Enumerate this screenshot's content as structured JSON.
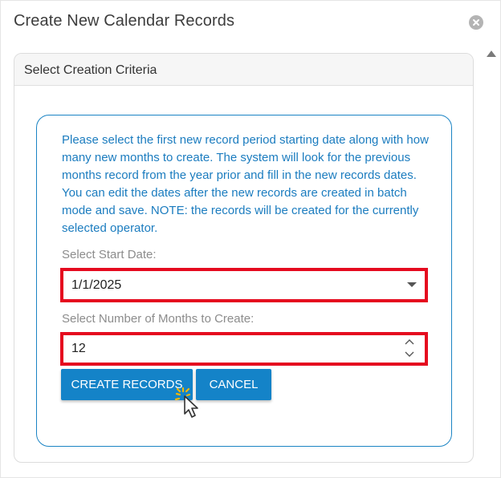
{
  "dialog": {
    "title": "Create New Calendar Records",
    "close_icon": "close-circle-icon",
    "scroll_icon": "scroll-up-arrow-icon"
  },
  "panel": {
    "header": "Select Creation Criteria",
    "instructions": "Please select the first new record period starting date along with how many new months to create. The system will look for the previous months record from the year prior and fill in the new records dates. You can edit the dates after the new records are created in batch mode and save. NOTE: the records will be created for the currently selected operator.",
    "start_date": {
      "label": "Select Start Date:",
      "value": "1/1/2025"
    },
    "months": {
      "label": "Select Number of Months to Create:",
      "value": "12"
    },
    "buttons": {
      "create": "CREATE RECORDS",
      "cancel": "CANCEL"
    }
  },
  "colors": {
    "accent": "#1483c8",
    "instruction_text": "#1b7cbf",
    "highlight_border": "#e50b1f"
  }
}
